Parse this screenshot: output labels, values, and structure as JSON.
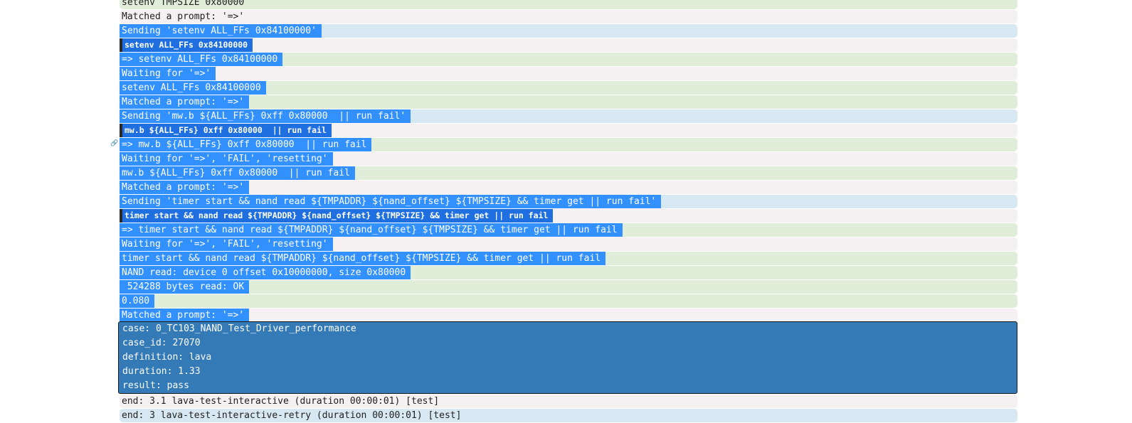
{
  "log_lines": [
    {
      "kind": "target",
      "text": "setenv TMPSIZE 0x80000",
      "selected": false
    },
    {
      "kind": "info",
      "text": "Matched a prompt: '=>'",
      "selected": false
    },
    {
      "kind": "input",
      "text": "Sending 'setenv ALL_FFs 0x84100000'",
      "selected": true
    },
    {
      "kind": "feedback",
      "text": "setenv ALL_FFs 0x84100000",
      "selected": true
    },
    {
      "kind": "target",
      "text": "=> setenv ALL_FFs 0x84100000",
      "selected": true
    },
    {
      "kind": "info",
      "text": "Waiting for '=>'",
      "selected": true
    },
    {
      "kind": "target",
      "text": "setenv ALL_FFs 0x84100000",
      "selected": true
    },
    {
      "kind": "target",
      "text": "Matched a prompt: '=>'",
      "selected": true
    },
    {
      "kind": "input",
      "text": "Sending 'mw.b ${ALL_FFs} 0xff 0x80000  || run fail'",
      "selected": true
    },
    {
      "kind": "feedback",
      "text": "mw.b ${ALL_FFs} 0xff 0x80000  || run fail",
      "selected": true
    },
    {
      "kind": "target",
      "text": "=> mw.b ${ALL_FFs} 0xff 0x80000  || run fail",
      "selected": true,
      "link": true
    },
    {
      "kind": "info",
      "text": "Waiting for '=>', 'FAIL', 'resetting'",
      "selected": true
    },
    {
      "kind": "target",
      "text": "mw.b ${ALL_FFs} 0xff 0x80000  || run fail",
      "selected": true
    },
    {
      "kind": "info",
      "text": "Matched a prompt: '=>'",
      "selected": true
    },
    {
      "kind": "input",
      "text": "Sending 'timer start && nand read ${TMPADDR} ${nand_offset} ${TMPSIZE} && timer get || run fail'",
      "selected": true
    },
    {
      "kind": "feedback",
      "text": "timer start && nand read ${TMPADDR} ${nand_offset} ${TMPSIZE} && timer get || run fail",
      "selected": true
    },
    {
      "kind": "target",
      "text": "=> timer start && nand read ${TMPADDR} ${nand_offset} ${TMPSIZE} && timer get || run fail",
      "selected": true
    },
    {
      "kind": "info",
      "text": "Waiting for '=>', 'FAIL', 'resetting'",
      "selected": true
    },
    {
      "kind": "target",
      "text": "timer start && nand read ${TMPADDR} ${nand_offset} ${TMPSIZE} && timer get || run fail",
      "selected": true
    },
    {
      "kind": "target",
      "text": "NAND read: device 0 offset 0x10000000, size 0x80000",
      "selected": true
    },
    {
      "kind": "target",
      "text": " 524288 bytes read: OK",
      "selected": true
    },
    {
      "kind": "target",
      "text": "0.080",
      "selected": true
    },
    {
      "kind": "info",
      "text": "Matched a prompt: '=>'",
      "selected": true
    }
  ],
  "results": [
    "case: 0_TC103_NAND_Test_Driver_performance",
    "case_id: 27070",
    "definition: lava",
    "duration: 1.33",
    "result: pass"
  ],
  "tail_lines": [
    {
      "kind": "info",
      "text": "end: 3.1 lava-test-interactive (duration 00:00:01) [test]"
    },
    {
      "kind": "input",
      "text": "end: 3 lava-test-interactive-retry (duration 00:00:01) [test]"
    }
  ],
  "icons": {
    "line_link": "link-icon"
  }
}
